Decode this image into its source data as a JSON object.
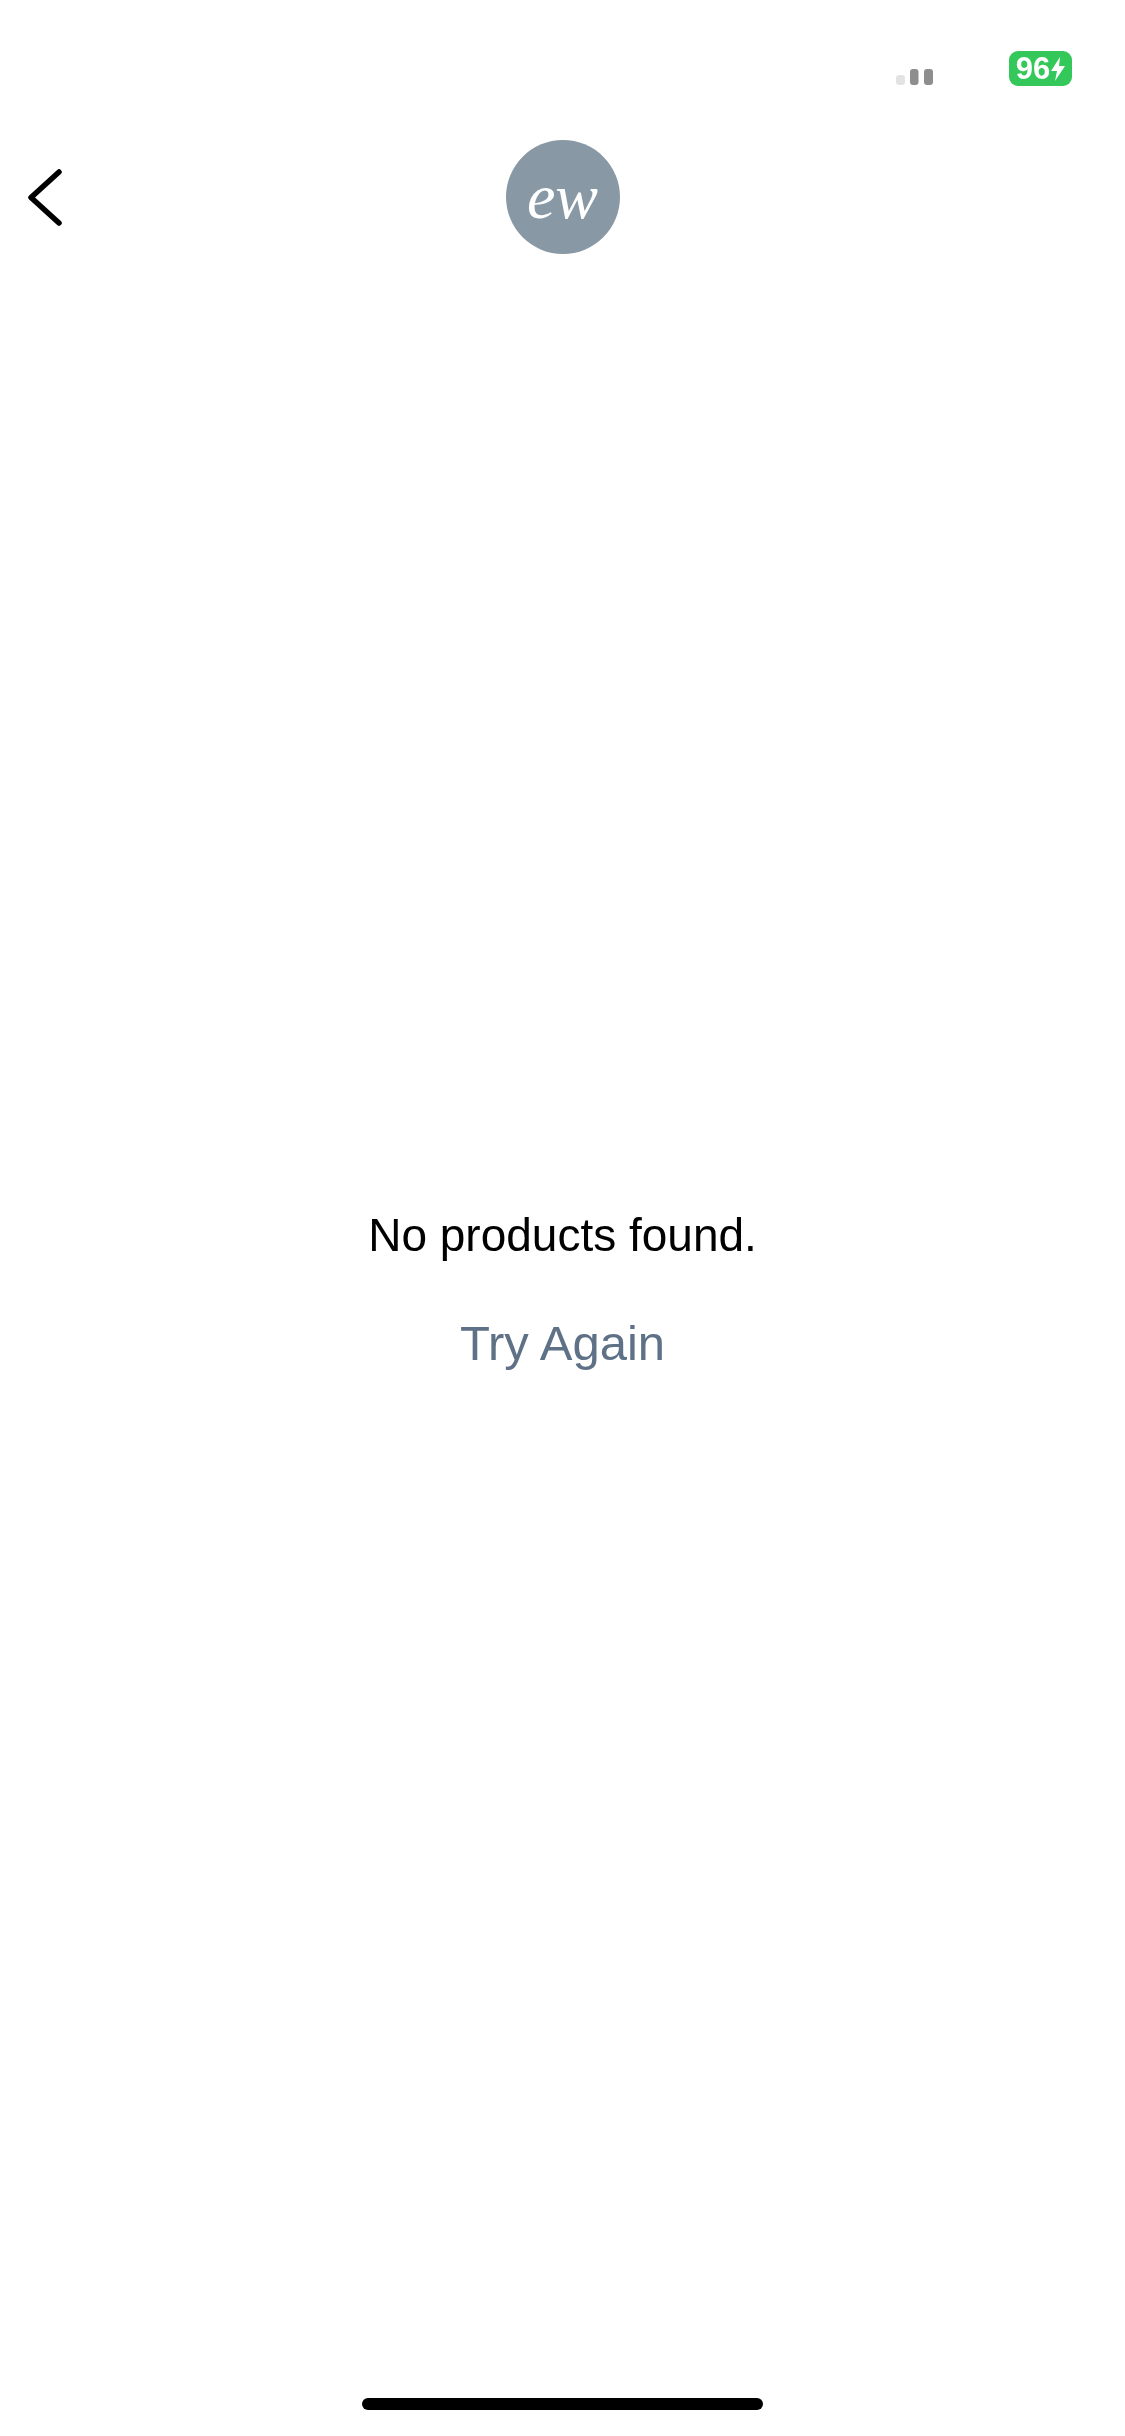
{
  "status_bar": {
    "battery": {
      "text": "96",
      "charging": true
    }
  },
  "nav": {
    "logo": {
      "text": "ew"
    }
  },
  "empty_state": {
    "message": "No products found.",
    "action": "Try Again"
  }
}
